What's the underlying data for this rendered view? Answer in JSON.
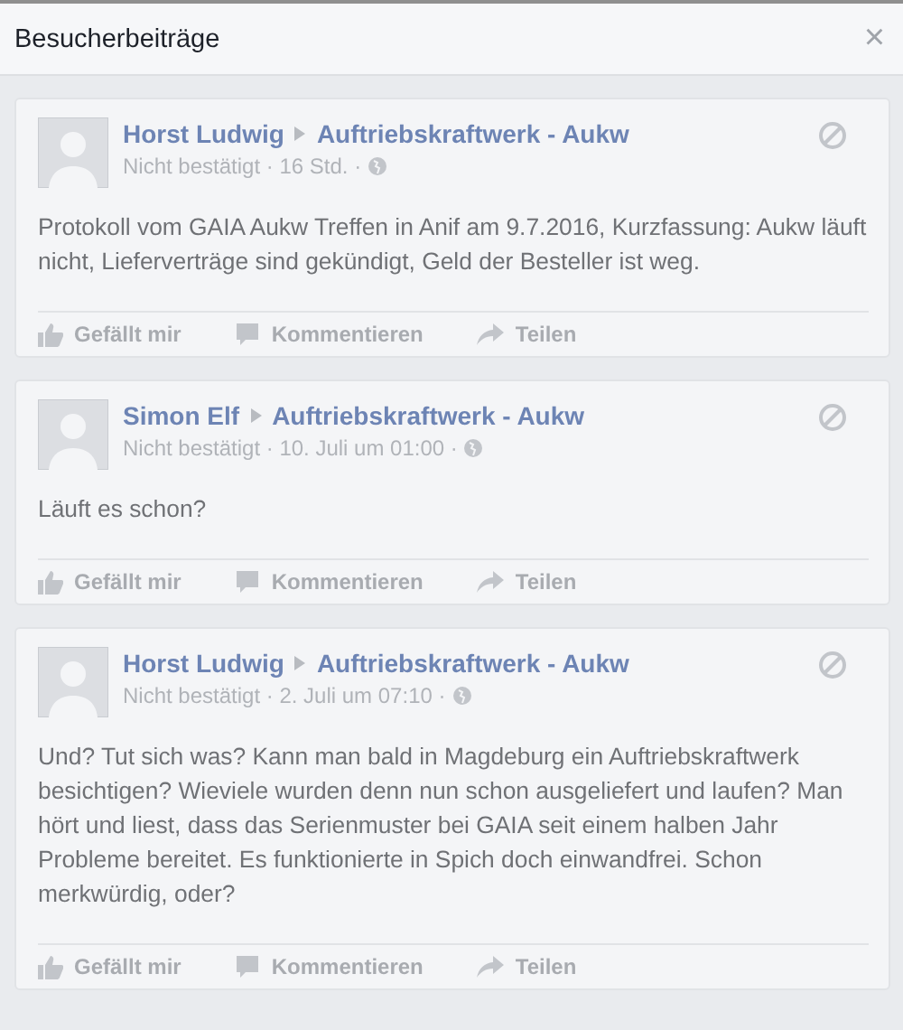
{
  "dialog": {
    "title": "Besucherbeiträge",
    "close": "×"
  },
  "posts": [
    {
      "author": "Horst Ludwig",
      "page": "Auftriebskraftwerk - Aukw",
      "meta": "Nicht bestätigt · 16 Std. ·",
      "text": "Protokoll vom GAIA Aukw Treffen in Anif am 9.7.2016, Kurzfassung: Aukw läuft nicht, Lieferverträge sind gekündigt, Geld der Besteller ist weg.",
      "actions": [
        "Gefällt mir",
        "Kommentieren",
        "Teilen"
      ]
    },
    {
      "author": "Simon Elf",
      "page": "Auftriebskraftwerk - Aukw",
      "meta": "Nicht bestätigt · 10. Juli um 01:00 ·",
      "text": "Läuft es schon?",
      "actions": [
        "Gefällt mir",
        "Kommentieren",
        "Teilen"
      ]
    },
    {
      "author": "Horst Ludwig",
      "page": "Auftriebskraftwerk - Aukw",
      "meta": "Nicht bestätigt · 2. Juli um 07:10 ·",
      "text": "Und? Tut sich was? Kann man bald in Magdeburg ein Auftriebskraftwerk besichtigen? Wieviele wurden denn nun schon ausgeliefert und laufen? Man hört und liest, dass das Serienmuster bei GAIA seit einem halben Jahr Probleme bereitet. Es funktionierte in Spich doch einwandfrei. Schon merkwürdig, oder?",
      "actions": [
        "Gefällt mir",
        "Kommentieren",
        "Teilen"
      ]
    }
  ]
}
